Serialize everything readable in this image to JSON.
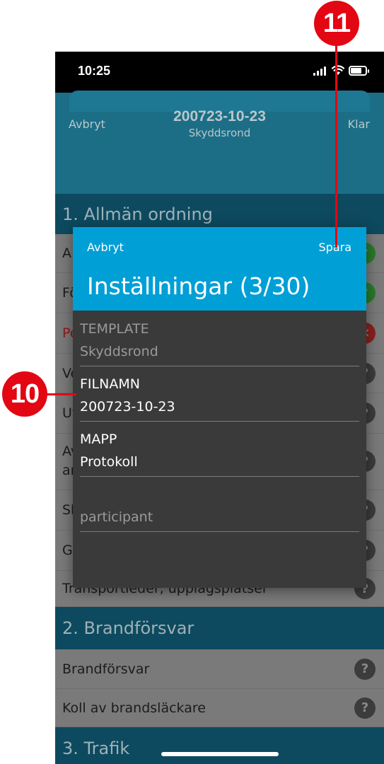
{
  "callouts": {
    "top": "11",
    "left": "10"
  },
  "status_bar": {
    "time": "10:25"
  },
  "nav": {
    "cancel": "Avbryt",
    "title": "200723-10-23",
    "subtitle": "Skyddsrond",
    "done": "Klar"
  },
  "sections": [
    {
      "title": "1. Allmän ordning",
      "rows": [
        {
          "label": "A",
          "status": "ok"
        },
        {
          "label": "Fö",
          "status": "ok"
        },
        {
          "label": "Pe",
          "status": "fail"
        },
        {
          "label": "Ve",
          "status": "?"
        },
        {
          "label": "Ut",
          "status": "?"
        },
        {
          "label": "Av",
          "label2": "ar",
          "status": "?"
        },
        {
          "label": "Sk",
          "status": "?"
        },
        {
          "label": "Gr",
          "status": "?"
        },
        {
          "label": "Transportleder, upplagsplatser",
          "status": "?"
        }
      ]
    },
    {
      "title": "2. Brandförsvar",
      "rows": [
        {
          "label": "Brandförsvar",
          "status": "?"
        },
        {
          "label": "Koll av brandsläckare",
          "status": "?"
        }
      ]
    },
    {
      "title": "3. Trafik",
      "rows": []
    }
  ],
  "modal": {
    "cancel": "Avbryt",
    "save": "Spara",
    "title": "Inställningar (3/30)",
    "fields": [
      {
        "label": "TEMPLATE",
        "value": "Skyddsrond"
      },
      {
        "label": "FILNAMN",
        "value": "200723-10-23"
      },
      {
        "label": "MAPP",
        "value": "Protokoll"
      },
      {
        "label": "",
        "value": "participant"
      }
    ]
  },
  "colors": {
    "accent": "#009fd6",
    "callout": "#e30613",
    "section": "#0d4a5f"
  }
}
